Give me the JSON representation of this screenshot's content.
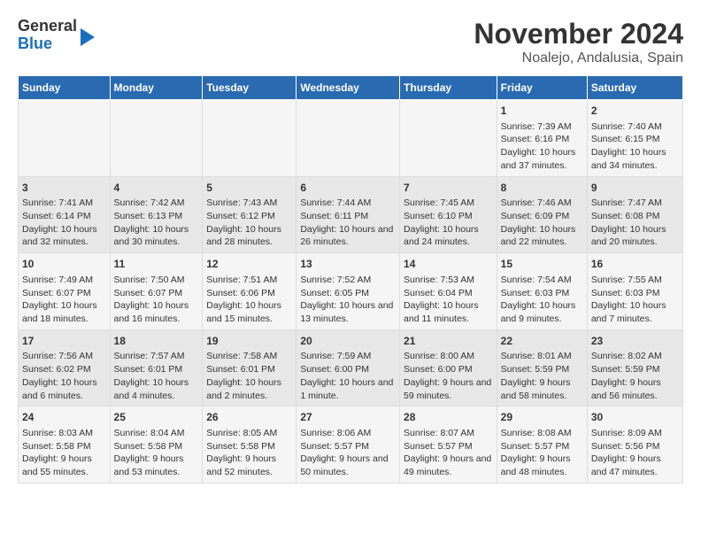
{
  "header": {
    "logo_line1": "General",
    "logo_line2": "Blue",
    "title": "November 2024",
    "subtitle": "Noalejo, Andalusia, Spain"
  },
  "days_of_week": [
    "Sunday",
    "Monday",
    "Tuesday",
    "Wednesday",
    "Thursday",
    "Friday",
    "Saturday"
  ],
  "weeks": [
    [
      {
        "day": "",
        "info": ""
      },
      {
        "day": "",
        "info": ""
      },
      {
        "day": "",
        "info": ""
      },
      {
        "day": "",
        "info": ""
      },
      {
        "day": "",
        "info": ""
      },
      {
        "day": "1",
        "info": "Sunrise: 7:39 AM\nSunset: 6:16 PM\nDaylight: 10 hours and 37 minutes."
      },
      {
        "day": "2",
        "info": "Sunrise: 7:40 AM\nSunset: 6:15 PM\nDaylight: 10 hours and 34 minutes."
      }
    ],
    [
      {
        "day": "3",
        "info": "Sunrise: 7:41 AM\nSunset: 6:14 PM\nDaylight: 10 hours and 32 minutes."
      },
      {
        "day": "4",
        "info": "Sunrise: 7:42 AM\nSunset: 6:13 PM\nDaylight: 10 hours and 30 minutes."
      },
      {
        "day": "5",
        "info": "Sunrise: 7:43 AM\nSunset: 6:12 PM\nDaylight: 10 hours and 28 minutes."
      },
      {
        "day": "6",
        "info": "Sunrise: 7:44 AM\nSunset: 6:11 PM\nDaylight: 10 hours and 26 minutes."
      },
      {
        "day": "7",
        "info": "Sunrise: 7:45 AM\nSunset: 6:10 PM\nDaylight: 10 hours and 24 minutes."
      },
      {
        "day": "8",
        "info": "Sunrise: 7:46 AM\nSunset: 6:09 PM\nDaylight: 10 hours and 22 minutes."
      },
      {
        "day": "9",
        "info": "Sunrise: 7:47 AM\nSunset: 6:08 PM\nDaylight: 10 hours and 20 minutes."
      }
    ],
    [
      {
        "day": "10",
        "info": "Sunrise: 7:49 AM\nSunset: 6:07 PM\nDaylight: 10 hours and 18 minutes."
      },
      {
        "day": "11",
        "info": "Sunrise: 7:50 AM\nSunset: 6:07 PM\nDaylight: 10 hours and 16 minutes."
      },
      {
        "day": "12",
        "info": "Sunrise: 7:51 AM\nSunset: 6:06 PM\nDaylight: 10 hours and 15 minutes."
      },
      {
        "day": "13",
        "info": "Sunrise: 7:52 AM\nSunset: 6:05 PM\nDaylight: 10 hours and 13 minutes."
      },
      {
        "day": "14",
        "info": "Sunrise: 7:53 AM\nSunset: 6:04 PM\nDaylight: 10 hours and 11 minutes."
      },
      {
        "day": "15",
        "info": "Sunrise: 7:54 AM\nSunset: 6:03 PM\nDaylight: 10 hours and 9 minutes."
      },
      {
        "day": "16",
        "info": "Sunrise: 7:55 AM\nSunset: 6:03 PM\nDaylight: 10 hours and 7 minutes."
      }
    ],
    [
      {
        "day": "17",
        "info": "Sunrise: 7:56 AM\nSunset: 6:02 PM\nDaylight: 10 hours and 6 minutes."
      },
      {
        "day": "18",
        "info": "Sunrise: 7:57 AM\nSunset: 6:01 PM\nDaylight: 10 hours and 4 minutes."
      },
      {
        "day": "19",
        "info": "Sunrise: 7:58 AM\nSunset: 6:01 PM\nDaylight: 10 hours and 2 minutes."
      },
      {
        "day": "20",
        "info": "Sunrise: 7:59 AM\nSunset: 6:00 PM\nDaylight: 10 hours and 1 minute."
      },
      {
        "day": "21",
        "info": "Sunrise: 8:00 AM\nSunset: 6:00 PM\nDaylight: 9 hours and 59 minutes."
      },
      {
        "day": "22",
        "info": "Sunrise: 8:01 AM\nSunset: 5:59 PM\nDaylight: 9 hours and 58 minutes."
      },
      {
        "day": "23",
        "info": "Sunrise: 8:02 AM\nSunset: 5:59 PM\nDaylight: 9 hours and 56 minutes."
      }
    ],
    [
      {
        "day": "24",
        "info": "Sunrise: 8:03 AM\nSunset: 5:58 PM\nDaylight: 9 hours and 55 minutes."
      },
      {
        "day": "25",
        "info": "Sunrise: 8:04 AM\nSunset: 5:58 PM\nDaylight: 9 hours and 53 minutes."
      },
      {
        "day": "26",
        "info": "Sunrise: 8:05 AM\nSunset: 5:58 PM\nDaylight: 9 hours and 52 minutes."
      },
      {
        "day": "27",
        "info": "Sunrise: 8:06 AM\nSunset: 5:57 PM\nDaylight: 9 hours and 50 minutes."
      },
      {
        "day": "28",
        "info": "Sunrise: 8:07 AM\nSunset: 5:57 PM\nDaylight: 9 hours and 49 minutes."
      },
      {
        "day": "29",
        "info": "Sunrise: 8:08 AM\nSunset: 5:57 PM\nDaylight: 9 hours and 48 minutes."
      },
      {
        "day": "30",
        "info": "Sunrise: 8:09 AM\nSunset: 5:56 PM\nDaylight: 9 hours and 47 minutes."
      }
    ]
  ]
}
